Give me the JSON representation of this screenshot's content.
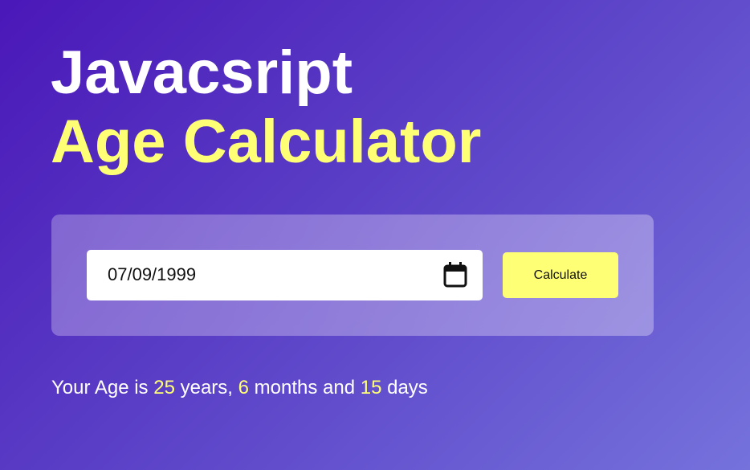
{
  "header": {
    "line1": "Javacsript",
    "line2": "Age Calculator"
  },
  "form": {
    "date_value": "07/09/1999",
    "calculate_label": "Calculate"
  },
  "result": {
    "prefix": "Your Age is ",
    "years": "25",
    "years_label": " years, ",
    "months": "6",
    "months_label": " months and ",
    "days": "15",
    "days_label": " days"
  },
  "icons": {
    "date_picker": "calendar-icon"
  },
  "colors": {
    "accent": "#ffff75",
    "text": "#ffffff",
    "background_start": "#4a17b8",
    "background_end": "#7572dc"
  }
}
